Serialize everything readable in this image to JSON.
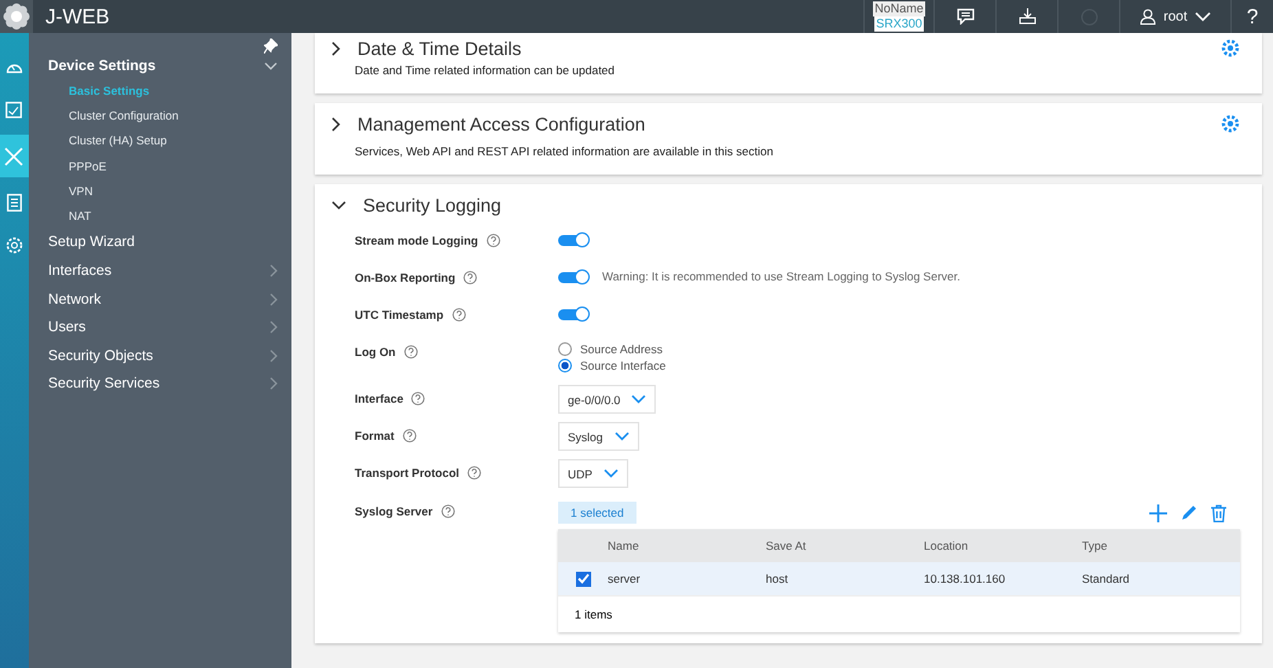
{
  "topbar": {
    "logo": "J-WEB",
    "device_name": "NoName",
    "device_model": "SRX300",
    "user": "root",
    "help": "?"
  },
  "rail": [
    {
      "selected": false
    },
    {
      "selected": false
    },
    {
      "selected": true
    },
    {
      "selected": false
    },
    {
      "selected": false
    }
  ],
  "sidebar": {
    "items": [
      {
        "label": "Device Settings",
        "expanded": true,
        "children": [
          {
            "label": "Basic Settings",
            "selected": true
          },
          {
            "label": "Cluster Configuration",
            "selected": false
          },
          {
            "label": "Cluster (HA) Setup",
            "selected": false
          },
          {
            "label": "PPPoE",
            "selected": false
          },
          {
            "label": "VPN",
            "selected": false
          },
          {
            "label": "NAT",
            "selected": false
          }
        ]
      },
      {
        "label": "Setup Wizard",
        "expanded": false,
        "has_children": false
      },
      {
        "label": "Interfaces",
        "expanded": false,
        "has_children": true
      },
      {
        "label": "Network",
        "expanded": false,
        "has_children": true
      },
      {
        "label": "Users",
        "expanded": false,
        "has_children": true
      },
      {
        "label": "Security Objects",
        "expanded": false,
        "has_children": true
      },
      {
        "label": "Security Services",
        "expanded": false,
        "has_children": true
      }
    ]
  },
  "sections": [
    {
      "title": "Date & Time Details",
      "description": "Date and Time related information can be updated",
      "expanded": false
    },
    {
      "title": "Management Access Configuration",
      "description": "Services, Web API and REST API related information are available in this section",
      "expanded": false
    },
    {
      "title": "Security Logging",
      "expanded": true,
      "fields": [
        {
          "kind": "toggle",
          "label": "Stream mode Logging",
          "on": true
        },
        {
          "kind": "toggle",
          "label": "On-Box Reporting",
          "on": true,
          "note": "Warning: It is recommended to use Stream Logging to Syslog Server."
        },
        {
          "kind": "toggle",
          "label": "UTC Timestamp",
          "on": true
        },
        {
          "kind": "radio",
          "label": "Log On",
          "options": [
            {
              "label": "Source Address",
              "selected": false
            },
            {
              "label": "Source Interface",
              "selected": true
            }
          ]
        },
        {
          "kind": "select",
          "label": "Interface",
          "value": "ge-0/0/0.0"
        },
        {
          "kind": "select",
          "label": "Format",
          "value": "Syslog"
        },
        {
          "kind": "select",
          "label": "Transport Protocol",
          "value": "UDP"
        },
        {
          "kind": "table",
          "label": "Syslog Server",
          "selection_badge": "1 selected",
          "columns": [
            "Name",
            "Save At",
            "Location",
            "Type"
          ],
          "rows": [
            {
              "checked": true,
              "cells": [
                "server",
                "host",
                "10.138.101.160",
                "Standard"
              ]
            }
          ],
          "footer": "1 items"
        }
      ]
    }
  ]
}
